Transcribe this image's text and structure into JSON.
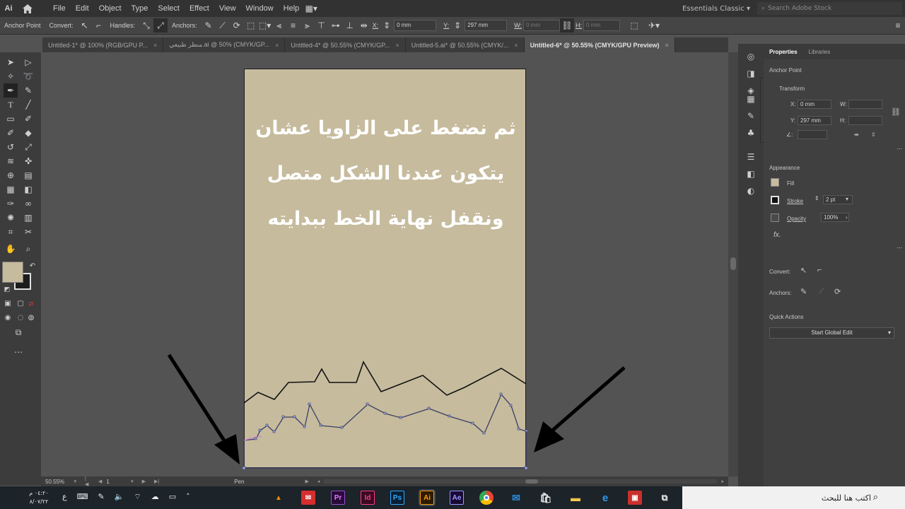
{
  "app": {
    "logo": "Ai"
  },
  "menu": [
    "File",
    "Edit",
    "Object",
    "Type",
    "Select",
    "Effect",
    "View",
    "Window",
    "Help"
  ],
  "workspace": "Essentials Classic",
  "stock_search_placeholder": "Search Adobe Stock",
  "control_bar": {
    "selection_label": "Anchor Point",
    "convert_label": "Convert:",
    "handles_label": "Handles:",
    "anchors_label": "Anchors:",
    "x_label": "X:",
    "x_value": "0 mm",
    "y_label": "Y:",
    "y_value": "297 mm",
    "w_label": "W:",
    "w_value": "0 mm",
    "h_label": "H:",
    "h_value": "0 mm"
  },
  "tabs": [
    {
      "label": "Untitled-1* @ 100% (RGB/GPU P..."
    },
    {
      "label": "منظر طبيعي.ai @ 50% (CMYK/GP..."
    },
    {
      "label": "Untitled-4* @ 50.55% (CMYK/GP..."
    },
    {
      "label": "Untitled-5.ai* @ 50.55% (CMYK/..."
    },
    {
      "label": "Untitled-6* @ 50.55% (CMYK/GPU Preview)",
      "active": true
    }
  ],
  "artboard": {
    "color": "#c6bb9d",
    "lines": [
      "ثم نضغط على الزاويا عشان",
      "يتكون عندنا الشكل متصل",
      "ونقفل نهاية الخط ببدايته"
    ]
  },
  "status": {
    "zoom": "50.55%",
    "artboard": "1",
    "tool": "Pen"
  },
  "properties": {
    "tabs": [
      "Properties",
      "Libraries"
    ],
    "selection": "Anchor Point",
    "transform_title": "Transform",
    "x_label": "X:",
    "x_value": "0 mm",
    "y_label": "Y:",
    "y_value": "297 mm",
    "w_label": "W:",
    "h_label": "H:",
    "angle_label": "∠:",
    "appearance_title": "Appearance",
    "fill_label": "Fill",
    "stroke_label": "Stroke",
    "stroke_value": "2 pt",
    "opacity_label": "Opacity",
    "opacity_value": "100%",
    "fx_label": "fx.",
    "convert_label": "Convert:",
    "anchors_label": "Anchors:",
    "quick_actions_title": "Quick Actions",
    "start_global_edit": "Start Global Edit"
  },
  "taskbar": {
    "time": "٠٤:٢٠ م",
    "date": "٨/٠٧/٢٢",
    "lang": "ع",
    "search_placeholder": "اكتب هنا للبحث",
    "apps": [
      "VLC",
      "Mail",
      "Pr",
      "Id",
      "Ps",
      "Ai",
      "Ae",
      "Chrome",
      "Mail",
      "Store",
      "Explorer",
      "Edge",
      "Gift",
      "Task View"
    ]
  }
}
